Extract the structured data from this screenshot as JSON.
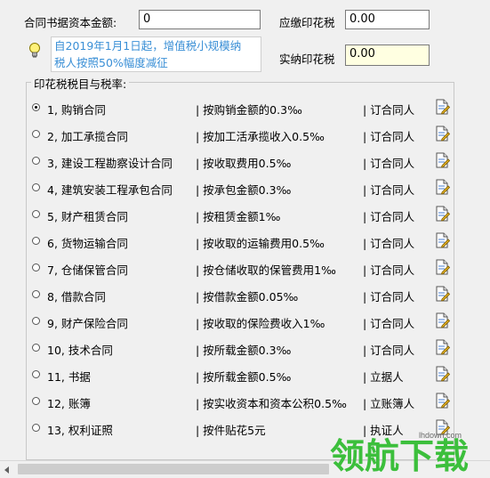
{
  "form": {
    "contract_amount_label": "合同书据资本金额:",
    "contract_amount_value": "0",
    "payable_label": "应缴印花税",
    "payable_value": "0.00",
    "actual_label": "实纳印花税",
    "actual_value": "0.00",
    "notice_line1": "自2019年1月1日起，增值税小规模纳",
    "notice_line2": "税人按照50%幅度减征"
  },
  "group_title": "印花税税目与税率:",
  "rates": [
    {
      "name": "1, 购销合同",
      "rule": "| 按购销金额的0.3‰",
      "payer": "| 订合同人",
      "selected": true
    },
    {
      "name": "2, 加工承揽合同",
      "rule": "| 按加工活承揽收入0.5‰",
      "payer": "| 订合同人",
      "selected": false
    },
    {
      "name": "3, 建设工程勘察设计合同",
      "rule": "| 按收取费用0.5‰",
      "payer": "| 订合同人",
      "selected": false
    },
    {
      "name": "4, 建筑安装工程承包合同",
      "rule": "| 按承包金额0.3‰",
      "payer": "| 订合同人",
      "selected": false
    },
    {
      "name": "5, 财产租赁合同",
      "rule": "| 按租赁金额1‰",
      "payer": "| 订合同人",
      "selected": false
    },
    {
      "name": "6, 货物运输合同",
      "rule": "| 按收取的运输费用0.5‰",
      "payer": "| 订合同人",
      "selected": false
    },
    {
      "name": "7, 仓储保管合同",
      "rule": "| 按仓储收取的保管费用1‰",
      "payer": "| 订合同人",
      "selected": false
    },
    {
      "name": "8, 借款合同",
      "rule": "| 按借款金额0.05‰",
      "payer": "| 订合同人",
      "selected": false
    },
    {
      "name": "9, 财产保险合同",
      "rule": "| 按收取的保险费收入1‰",
      "payer": "| 订合同人",
      "selected": false
    },
    {
      "name": "10, 技术合同",
      "rule": "| 按所载金额0.3‰",
      "payer": "| 订合同人",
      "selected": false
    },
    {
      "name": "11, 书据",
      "rule": "| 按所载金额0.5‰",
      "payer": "| 立据人",
      "selected": false
    },
    {
      "name": "12, 账簿",
      "rule": "| 按实收资本和资本公积0.5‰",
      "payer": "| 立账簿人",
      "selected": false
    },
    {
      "name": "13, 权利证照",
      "rule": "| 按件贴花5元",
      "payer": "| 执证人",
      "selected": false
    }
  ],
  "watermark": {
    "text": "领航下载",
    "url": "lhdown.com"
  },
  "colors": {
    "notice_text": "#3a8fd6",
    "actual_field_bg": "#ffffe1",
    "watermark_green": "#3cbf3c"
  }
}
